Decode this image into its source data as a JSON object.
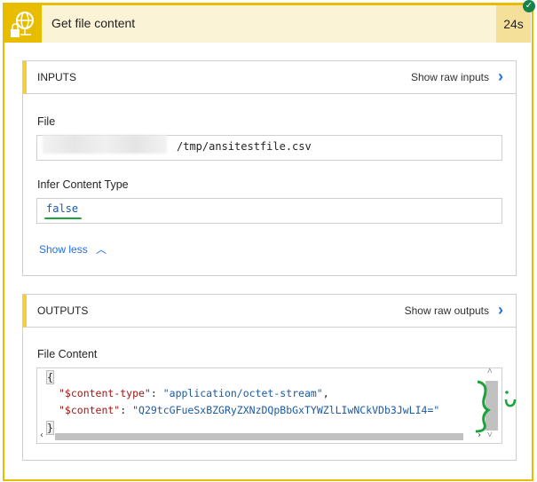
{
  "action": {
    "title": "Get file content",
    "duration": "24s",
    "status_icon": "check-icon",
    "icon": "globe-lock-icon"
  },
  "inputs": {
    "header": "INPUTS",
    "show_raw": "Show raw inputs",
    "fields": [
      {
        "label": "File",
        "value": "/tmp/ansitestfile.csv"
      },
      {
        "label": "Infer Content Type",
        "value": "false"
      }
    ],
    "show_less": "Show less"
  },
  "outputs": {
    "header": "OUTPUTS",
    "show_raw": "Show raw outputs",
    "field_label": "File Content",
    "code": {
      "open": "{",
      "key1": "\"$content-type\"",
      "val1": "\"application/octet-stream\"",
      "key2": "\"$content\"",
      "val2": "\"Q29tcGFueSxBZGRyZXNzDQpBbGxTYWZlLIwNCkVDb3JwLI4=\"",
      "close": "}"
    }
  },
  "colors": {
    "accent": "#e8bd00",
    "link": "#1f6feb",
    "annotation": "#1aa33a"
  }
}
